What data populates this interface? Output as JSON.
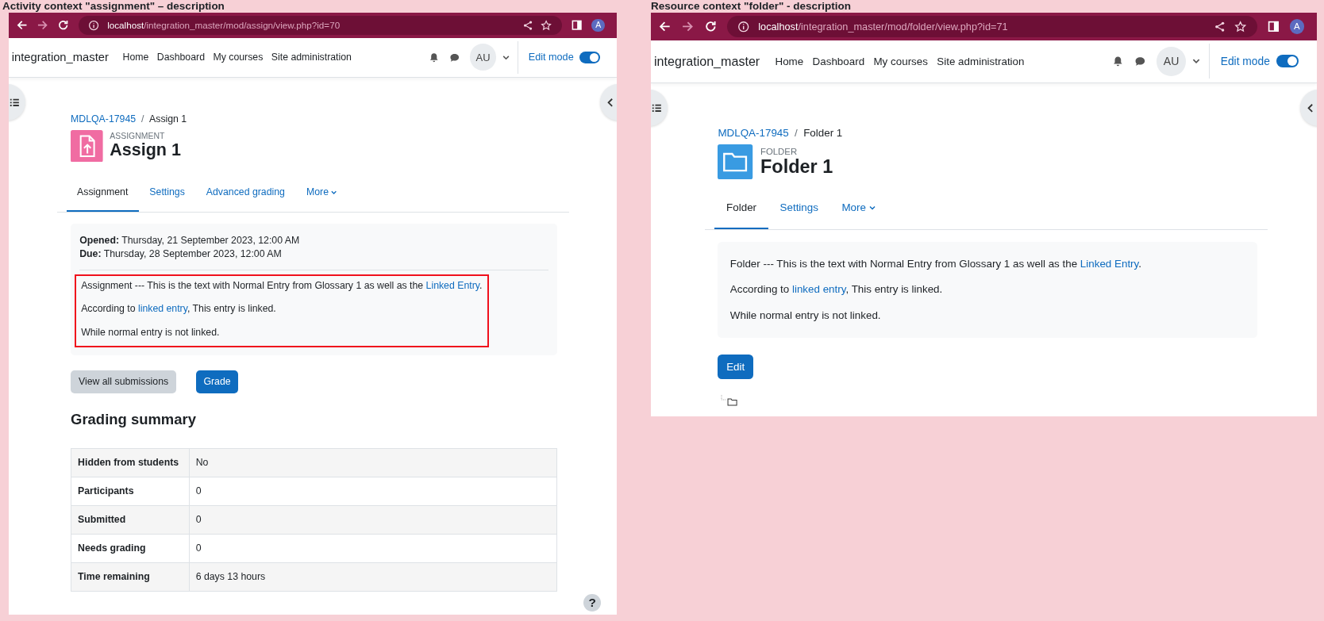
{
  "windows": [
    {
      "kind": "assignment",
      "caption": "Activity context \"assignment\" – description",
      "browser": {
        "url_host": "localhost",
        "url_path": "/integration_master/mod/assign/view.php?id=70",
        "profile": "A"
      },
      "navbar": {
        "site_name": "integration_master",
        "links": [
          "Home",
          "Dashboard",
          "My courses",
          "Site administration"
        ],
        "user_initials": "AU",
        "edit_mode": {
          "label": "Edit mode",
          "on": true
        }
      },
      "breadcrumb": {
        "course": "MDLQA-17945",
        "separator": "/",
        "current": "Assign 1"
      },
      "activity_type": "ASSIGNMENT",
      "title": "Assign 1",
      "tabs": [
        {
          "label": "Assignment",
          "kind": "tab",
          "selected": true
        },
        {
          "label": "Settings",
          "kind": "tab",
          "selected": false
        },
        {
          "label": "Advanced grading",
          "kind": "tab",
          "selected": false
        },
        {
          "label": "More",
          "kind": "dropdown",
          "selected": false
        }
      ],
      "dates": [
        "**Opened:** Thursday, 21 September 2023, 12:00 AM",
        "**Due:** Thursday, 28 September 2023, 12:00 AM"
      ],
      "description": {
        "highlighted": true,
        "paragraphs": [
          [
            {
              "text": "Assignment --- This is the text with Normal Entry from Glossary 1 as well as the "
            },
            {
              "link": "Linked Entry"
            },
            {
              "text": "."
            }
          ],
          [
            {
              "text": "According to "
            },
            {
              "link": "linked entry"
            },
            {
              "text": ", This entry is linked."
            }
          ],
          [
            {
              "text": "While normal entry is not linked."
            }
          ]
        ]
      },
      "buttons": [
        {
          "label": "View all submissions",
          "kind": "secondary"
        },
        {
          "label": "Grade",
          "kind": "primary"
        }
      ],
      "grading_summary": {
        "heading": "Grading summary",
        "rows": [
          {
            "label": "Hidden from students",
            "value": "No"
          },
          {
            "label": "Participants",
            "value": "0"
          },
          {
            "label": "Submitted",
            "value": "0"
          },
          {
            "label": "Needs grading",
            "value": "0"
          },
          {
            "label": "Time remaining",
            "value": "6 days 13 hours"
          }
        ]
      },
      "help_button": "?"
    },
    {
      "kind": "folder",
      "caption": "Resource context \"folder\" - description",
      "browser": {
        "url_host": "localhost",
        "url_path": "/integration_master/mod/folder/view.php?id=71",
        "profile": "A"
      },
      "navbar": {
        "site_name": "integration_master",
        "links": [
          "Home",
          "Dashboard",
          "My courses",
          "Site administration"
        ],
        "user_initials": "AU",
        "edit_mode": {
          "label": "Edit mode",
          "on": true
        }
      },
      "breadcrumb": {
        "course": "MDLQA-17945",
        "separator": "/",
        "current": "Folder 1"
      },
      "activity_type": "FOLDER",
      "title": "Folder 1",
      "tabs": [
        {
          "label": "Folder",
          "kind": "tab",
          "selected": true
        },
        {
          "label": "Settings",
          "kind": "tab",
          "selected": false
        },
        {
          "label": "More",
          "kind": "dropdown",
          "selected": false
        }
      ],
      "description": {
        "paragraphs": [
          [
            {
              "text": "Folder --- This is the text with Normal Entry from Glossary 1 as well as the "
            },
            {
              "link": "Linked Entry"
            },
            {
              "text": "."
            }
          ],
          [
            {
              "text": "According to "
            },
            {
              "link": "linked entry"
            },
            {
              "text": ", This entry is linked."
            }
          ],
          [
            {
              "text": "While normal entry is not linked."
            }
          ]
        ]
      },
      "buttons": [
        {
          "label": "Edit",
          "kind": "primary"
        }
      ]
    }
  ]
}
